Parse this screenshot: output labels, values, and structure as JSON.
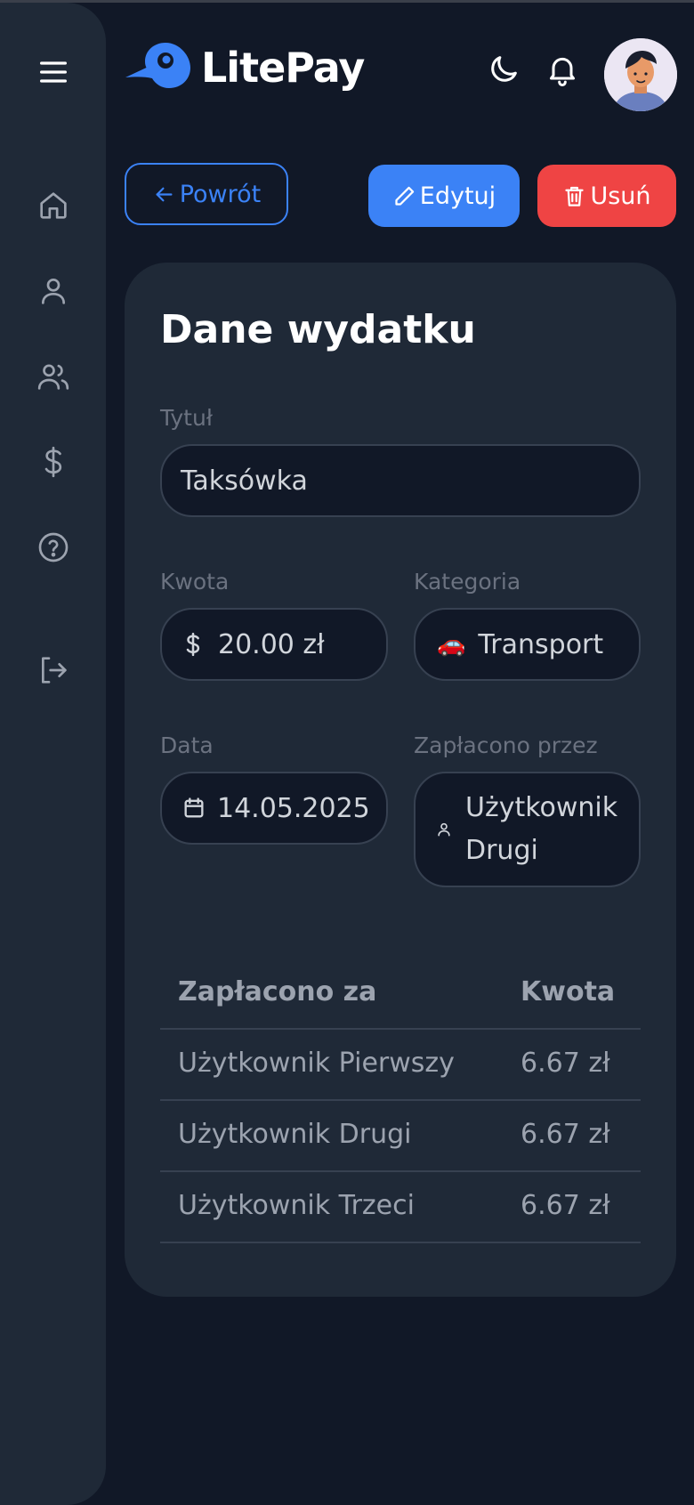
{
  "app": {
    "name": "LitePay"
  },
  "sidebar": {
    "items": [
      {
        "icon": "menu-icon"
      },
      {
        "icon": "home-icon"
      },
      {
        "icon": "user-icon"
      },
      {
        "icon": "users-icon"
      },
      {
        "icon": "dollar-icon"
      },
      {
        "icon": "help-icon"
      },
      {
        "icon": "logout-icon"
      }
    ]
  },
  "header": {
    "theme_icon": "moon-icon",
    "notifications_icon": "bell-icon",
    "avatar": "avatar"
  },
  "actions": {
    "back_label": "Powrót",
    "edit_label": "Edytuj",
    "delete_label": "Usuń"
  },
  "expense": {
    "heading": "Dane wydatku",
    "title_label": "Tytuł",
    "title_value": "Taksówka",
    "amount_label": "Kwota",
    "amount_value": "20.00 zł",
    "category_label": "Kategoria",
    "category_emoji": "🚗",
    "category_value": "Transport",
    "date_label": "Data",
    "date_value": "14.05.2025",
    "paid_by_label": "Zapłacono przez",
    "paid_by_value_line1": "Użytkownik",
    "paid_by_value_line2": "Drugi"
  },
  "split_table": {
    "headers": {
      "who": "Zapłacono za",
      "amount": "Kwota"
    },
    "rows": [
      {
        "who": "Użytkownik Pierwszy",
        "amount": "6.67 zł"
      },
      {
        "who": "Użytkownik Drugi",
        "amount": "6.67 zł"
      },
      {
        "who": "Użytkownik Trzeci",
        "amount": "6.67 zł"
      }
    ]
  },
  "colors": {
    "primary": "#3b82f6",
    "danger": "#ef4444",
    "card": "#1f2937",
    "background": "#111827"
  }
}
